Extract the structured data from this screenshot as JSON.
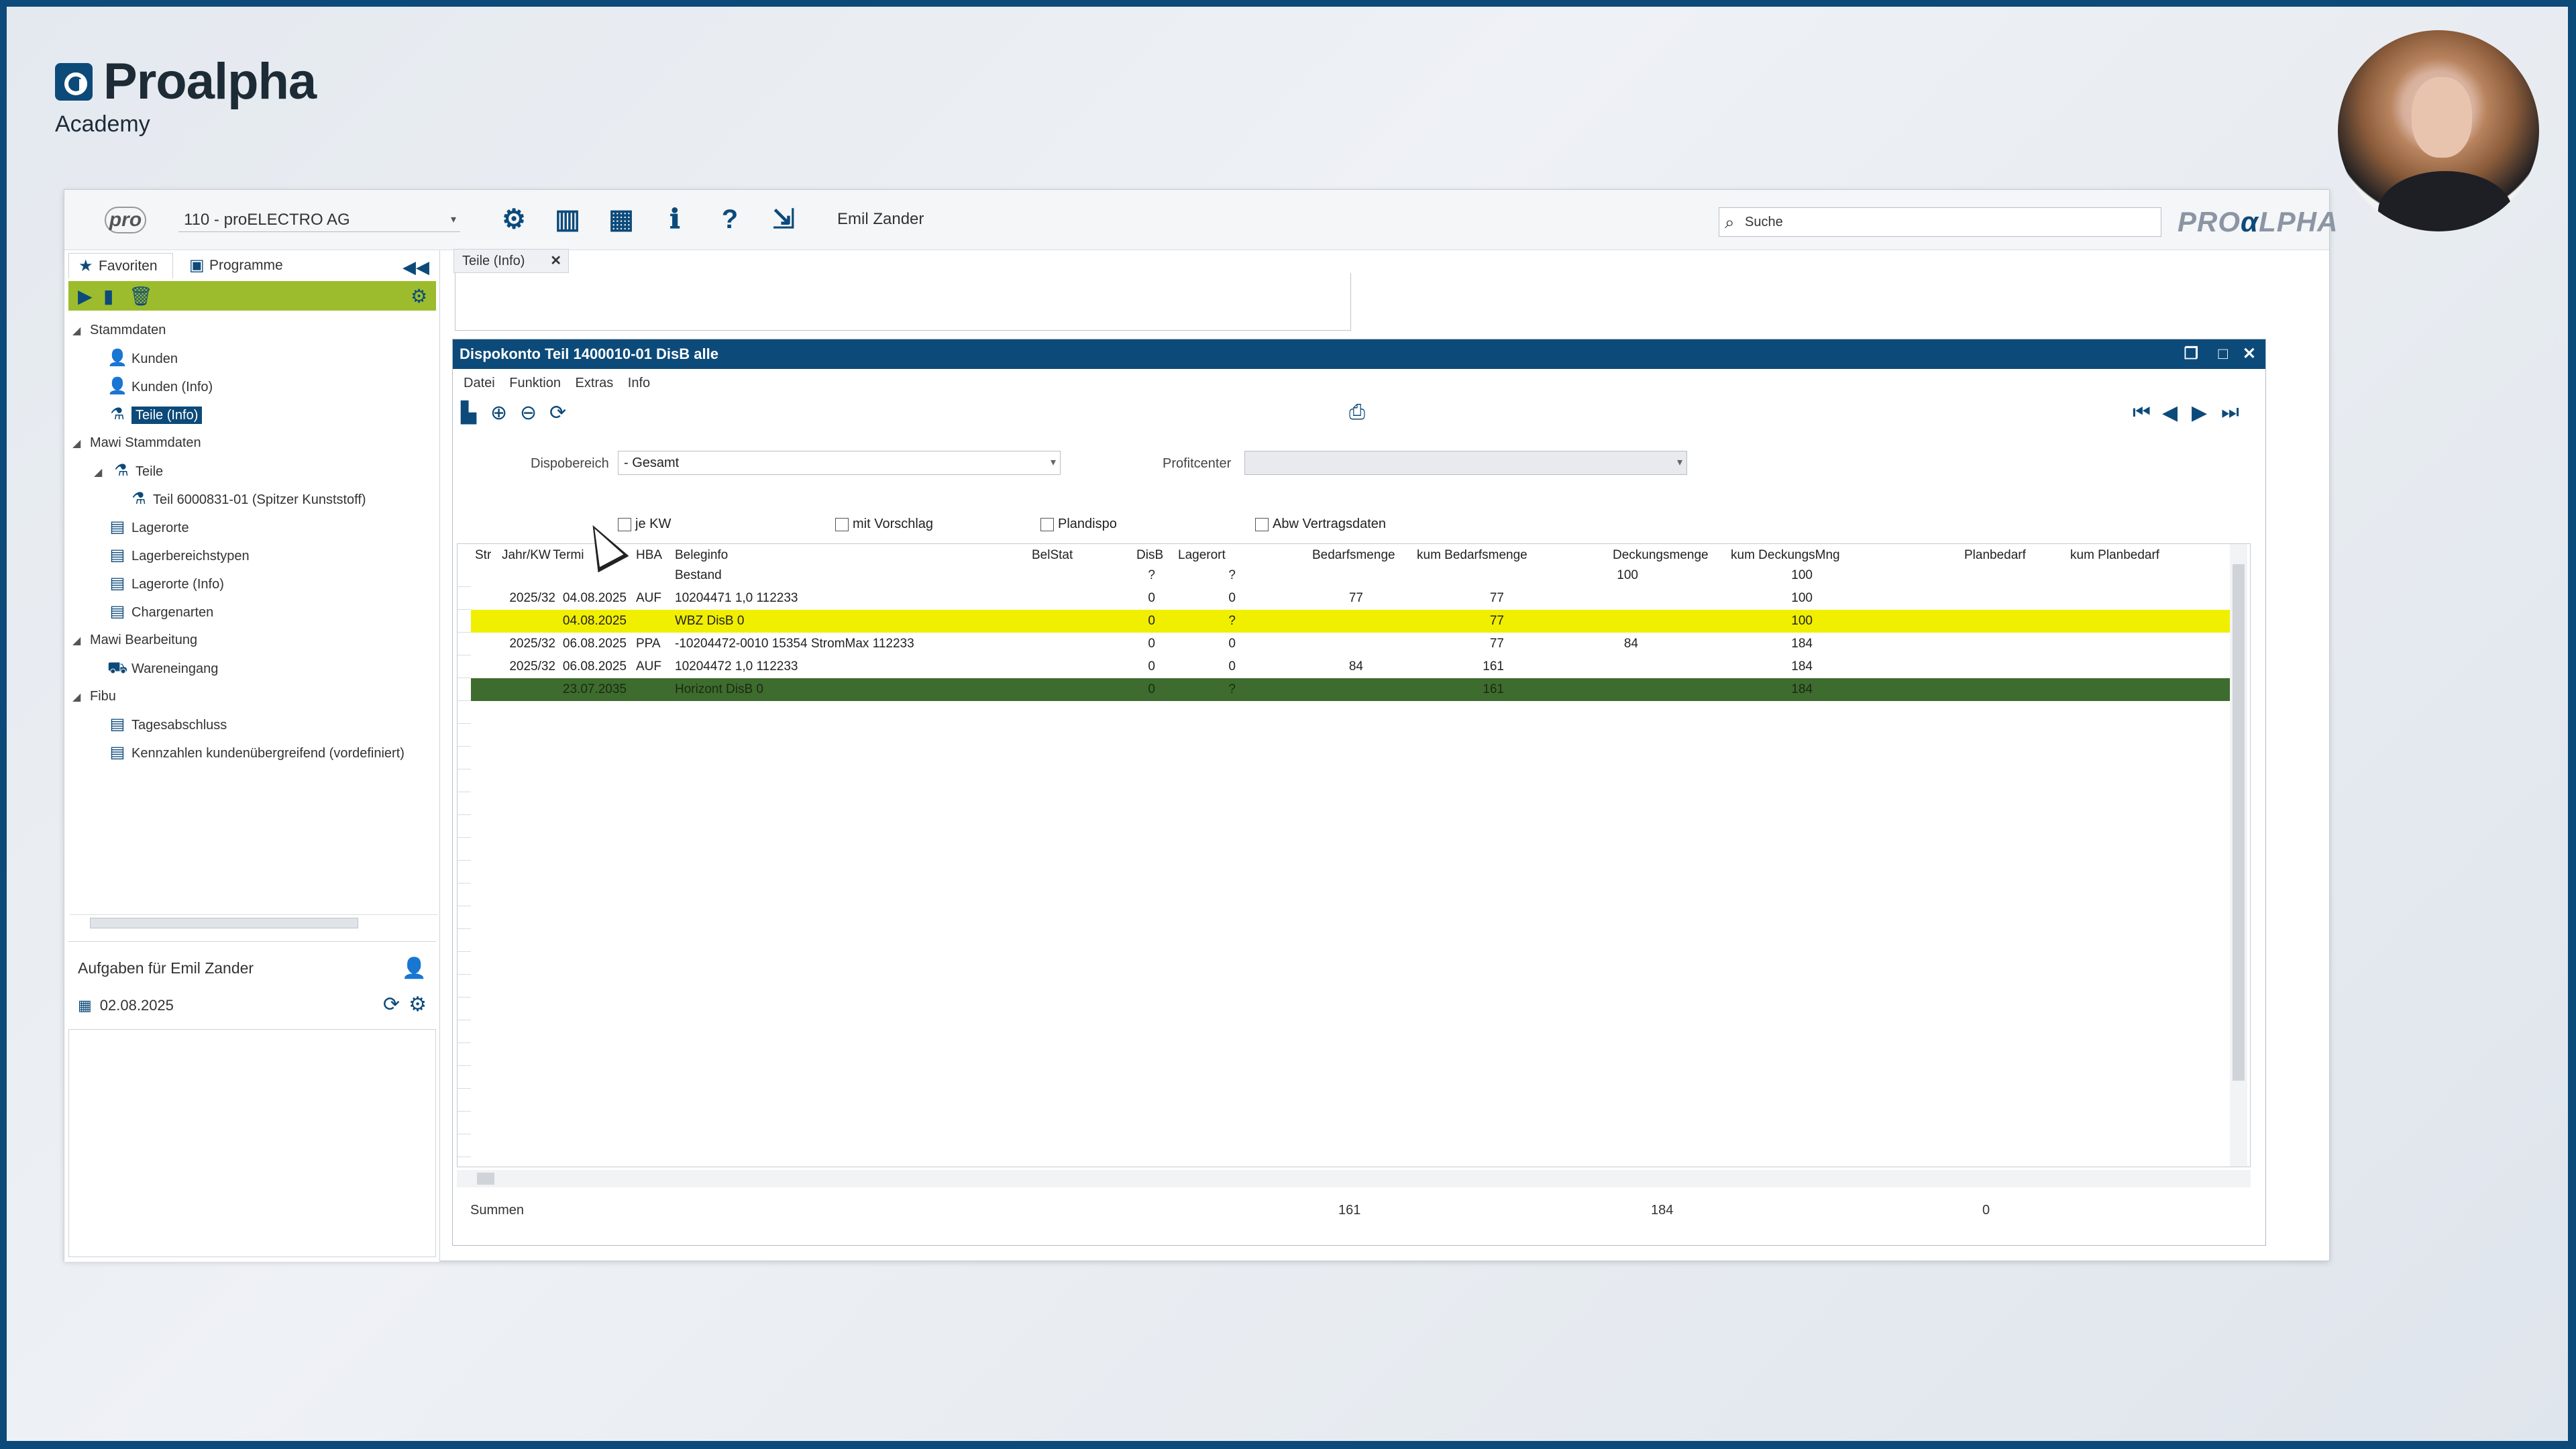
{
  "brand": {
    "name": "Proalpha",
    "sub": "Academy"
  },
  "topbar": {
    "company": "110 - proELECTRO AG",
    "user": "Emil Zander",
    "search_placeholder": "Suche",
    "logo_a": "PRO",
    "logo_b": "α",
    "logo_c": "LPHA",
    "pro_badge": "pro"
  },
  "left": {
    "tabs": [
      {
        "label": "Favoriten"
      },
      {
        "label": "Programme"
      }
    ],
    "tree": [
      {
        "label": "Stammdaten"
      },
      {
        "label": "Kunden"
      },
      {
        "label": "Kunden (Info)"
      },
      {
        "label": "Teile (Info)"
      },
      {
        "label": "Mawi Stammdaten"
      },
      {
        "label": "Teile"
      },
      {
        "label": "Teil 6000831-01 (Spitzer Kunststoff)"
      },
      {
        "label": "Lagerorte"
      },
      {
        "label": "Lagerbereichstypen"
      },
      {
        "label": "Lagerorte (Info)"
      },
      {
        "label": "Chargenarten"
      },
      {
        "label": "Mawi Bearbeitung"
      },
      {
        "label": "Wareneingang"
      },
      {
        "label": "Fibu"
      },
      {
        "label": "Tagesabschluss"
      },
      {
        "label": "Kennzahlen kundenübergreifend (vordefiniert)"
      }
    ],
    "tasks_title": "Aufgaben für Emil Zander",
    "tasks_date": "02.08.2025"
  },
  "doc_tab": "Teile (Info)",
  "dialog": {
    "title": "Dispokonto  Teil 1400010-01 DisB alle",
    "menu": [
      "Datei",
      "Funktion",
      "Extras",
      "Info"
    ],
    "dispobereich_label": "Dispobereich",
    "dispobereich_value": "- Gesamt",
    "profitcenter_label": "Profitcenter",
    "checkboxes": [
      "je KW",
      "mit Vorschlag",
      "Plandispo",
      "Abw Vertragsdaten"
    ]
  },
  "grid": {
    "headers": [
      "Str",
      "Jahr/KW",
      "Termi",
      "HBA",
      "Beleginfo",
      "BelStat",
      "DisB",
      "Lagerort",
      "Bedarfsmenge",
      "kum Bedarfsmenge",
      "Deckungsmenge",
      "kum DeckungsMng",
      "Planbedarf",
      "kum Planbedarf"
    ],
    "rows": [
      {
        "kw": "",
        "termin": "",
        "hba": "",
        "info": "Bestand",
        "belstat": "",
        "disb": "?",
        "lagerort": "?",
        "bedarf": "",
        "kumbedarf": "",
        "deckung": "100",
        "kumdeckung": "100"
      },
      {
        "kw": "2025/32",
        "termin": "04.08.2025",
        "hba": "AUF",
        "info": "10204471   1,0 112233",
        "belstat": "",
        "disb": "0",
        "lagerort": "0",
        "bedarf": "77",
        "kumbedarf": "77",
        "deckung": "",
        "kumdeckung": "100"
      },
      {
        "kw": "",
        "termin": "04.08.2025",
        "hba": "",
        "info": "WBZ DisB 0",
        "belstat": "",
        "disb": "0",
        "lagerort": "?",
        "bedarf": "",
        "kumbedarf": "77",
        "deckung": "",
        "kumdeckung": "100"
      },
      {
        "kw": "2025/32",
        "termin": "06.08.2025",
        "hba": "PPA",
        "info": "-10204472-0010 15354 StromMax 112233",
        "belstat": "",
        "disb": "0",
        "lagerort": "0",
        "bedarf": "",
        "kumbedarf": "77",
        "deckung": "84",
        "kumdeckung": "184"
      },
      {
        "kw": "2025/32",
        "termin": "06.08.2025",
        "hba": "AUF",
        "info": "10204472   1,0 112233",
        "belstat": "",
        "disb": "0",
        "lagerort": "0",
        "bedarf": "84",
        "kumbedarf": "161",
        "deckung": "",
        "kumdeckung": "184"
      },
      {
        "kw": "",
        "termin": "23.07.2035",
        "hba": "",
        "info": "Horizont DisB 0",
        "belstat": "",
        "disb": "0",
        "lagerort": "?",
        "bedarf": "",
        "kumbedarf": "161",
        "deckung": "",
        "kumdeckung": "184"
      }
    ]
  },
  "sums": {
    "label": "Summen",
    "bedarf": "161",
    "deckung": "184",
    "plan": "0"
  },
  "colors": {
    "brand": "#0c4a7a",
    "green_bar": "#9cbc2d",
    "highlight_yellow": "#f1ef00",
    "highlight_green": "#3e6b2e"
  }
}
